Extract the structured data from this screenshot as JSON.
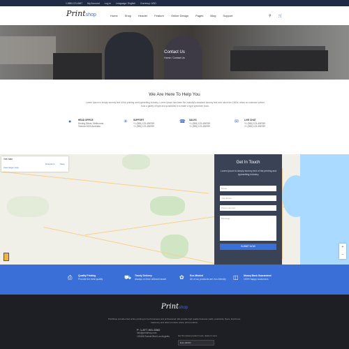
{
  "topbar": {
    "phone": "1-888-123-4567",
    "account": "My Account",
    "login": "Log in",
    "language": "Language: English",
    "currency": "Currency: USD"
  },
  "header": {
    "logo_main": "Print",
    "logo_suffix": "shop",
    "nav": [
      "Home",
      "Shop",
      "Header",
      "Feature",
      "Online Design",
      "Pages",
      "Blog",
      "Support"
    ],
    "icons": [
      "search-icon",
      "cart-icon"
    ]
  },
  "hero": {
    "title": "Contact Us",
    "breadcrumb": "Home / Contact Us"
  },
  "help": {
    "title": "We Are Here To Help You",
    "text": "Lorem Ipsum is simply dummy text of the printing and typesetting industry. Lorem Ipsum has been the industry's standard dummy text ever since the 1500s, when an unknown printer took a galley of type and scrambled it to make a type specimen book.",
    "contacts": [
      {
        "icon": "location-pin-icon",
        "title": "HEAD OFFICE",
        "line1": "Dnning Street, Melbourne,",
        "line2": "Victoria 3000 Australia"
      },
      {
        "icon": "support-icon",
        "title": "SUPPORT",
        "line1": "+1 (555) 123-456789",
        "line2": "+1 (555) 123-456789"
      },
      {
        "icon": "phone-icon",
        "title": "SALES",
        "line1": "+1 (555) 123-456789",
        "line2": "+1 (555) 123-456789"
      },
      {
        "icon": "chat-icon",
        "title": "LIVE CHAT",
        "line1": "+1 (555) 123-456789",
        "line2": "+1 (555) 123-456789"
      }
    ]
  },
  "map": {
    "place": "Viet Nam",
    "link": "View larger map",
    "directions": "Directions",
    "save": "Save"
  },
  "form": {
    "title": "Get In Touch",
    "description": "Lorem Ipsum is simply dummy text of the printing and typesetting industry.",
    "fields": {
      "name": "Name",
      "email": "Your Email",
      "phone": "Phone Number",
      "message": "Message"
    },
    "submit": "SUBMIT NOW"
  },
  "features": [
    {
      "icon": "print-icon",
      "title": "Quality Printing",
      "subtitle": "Provide the best quality"
    },
    {
      "icon": "truck-icon",
      "title": "Timely Delivery",
      "subtitle": "Always on time without hassle"
    },
    {
      "icon": "leaf-icon",
      "title": "Eco-Minded",
      "subtitle": "All of our products are eco-friendly"
    },
    {
      "icon": "money-icon",
      "title": "Money Back Guaranteed",
      "subtitle": "100% happy customers"
    }
  ],
  "footer": {
    "logo_main": "Print",
    "logo_suffix": "shop",
    "description": "PrintShop provides fast online printing for both business and professional. We provide high quality business cards, postcards, flyers, brochures, stationery and other premium online print products.",
    "phone": "P: 1-877-901-5362",
    "email": "info@printshop.com",
    "address": "123456 Sunset Blvd Los Angeles",
    "newsletter": "Get the latest product news, deals & more",
    "currency_select": "Euro (EUR)"
  },
  "colors": {
    "accent": "#3b6fd8",
    "topbar": "#1f2a44",
    "footer": "#1e1f24",
    "form_panel": "#3a4356"
  }
}
